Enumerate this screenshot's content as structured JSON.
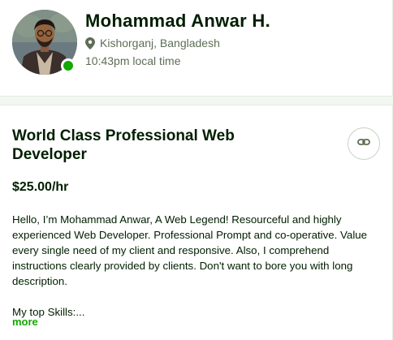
{
  "profile": {
    "name": "Mohammad Anwar H.",
    "location": "Kishorganj, Bangladesh",
    "local_time": "10:43pm local time",
    "online": true
  },
  "job": {
    "title": "World Class Professional Web Developer",
    "rate": "$25.00/hr",
    "description": "Hello, I’m Mohammad Anwar, A Web Legend! Resourceful and highly experienced Web Developer. Professional Prompt and co-operative. Value every single need of my client and responsive. Also, I comprehend instructions clearly provided by clients. Don't want to bore you with long description.",
    "skills_teaser": "My top Skills:...",
    "more_label": "more"
  },
  "icons": {
    "location": "map-pin-icon",
    "link": "link-icon",
    "status": "online-status-dot"
  },
  "colors": {
    "accent_green": "#14a800",
    "text_primary": "#001e00",
    "text_muted": "#5e6d55",
    "divider": "#f2f7f2"
  }
}
